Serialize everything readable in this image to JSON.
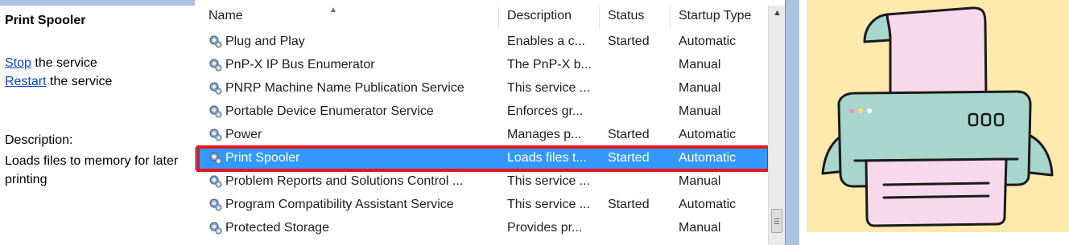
{
  "left_panel": {
    "service_title": "Print Spooler",
    "actions": [
      {
        "link": "Stop",
        "rest": " the service"
      },
      {
        "link": "Restart",
        "rest": " the service"
      }
    ],
    "description_label": "Description:",
    "description_text": "Loads files to memory for later printing"
  },
  "list": {
    "columns": [
      "Name",
      "Description",
      "Status",
      "Startup Type"
    ],
    "rows": [
      {
        "name": "Plug and Play",
        "description": "Enables a c...",
        "status": "Started",
        "startup": "Automatic"
      },
      {
        "name": "PnP-X IP Bus Enumerator",
        "description": "The PnP-X b...",
        "status": "",
        "startup": "Manual"
      },
      {
        "name": "PNRP Machine Name Publication Service",
        "description": "This service ...",
        "status": "",
        "startup": "Manual"
      },
      {
        "name": "Portable Device Enumerator Service",
        "description": "Enforces gr...",
        "status": "",
        "startup": "Manual"
      },
      {
        "name": "Power",
        "description": "Manages p...",
        "status": "Started",
        "startup": "Automatic"
      },
      {
        "name": "Print Spooler",
        "description": "Loads files t...",
        "status": "Started",
        "startup": "Automatic",
        "selected": true
      },
      {
        "name": "Problem Reports and Solutions Control ...",
        "description": "This service ...",
        "status": "",
        "startup": "Manual"
      },
      {
        "name": "Program Compatibility Assistant Service",
        "description": "This service ...",
        "status": "Started",
        "startup": "Automatic"
      },
      {
        "name": "Protected Storage",
        "description": "Provides pr...",
        "status": "",
        "startup": "Manual"
      }
    ]
  },
  "icons": {
    "service": "gear-icon",
    "sort": "sort-ascending-icon",
    "scroll_up": "scroll-up-arrow-icon",
    "illustration": "printer-illustration"
  },
  "colors": {
    "selection": "#3399ff",
    "highlight_border": "#e8141b",
    "link": "#0645c8",
    "illustration_bg": "#ffe9ad",
    "printer_body": "#a8d5cc",
    "paper": "#f8d9ec"
  }
}
